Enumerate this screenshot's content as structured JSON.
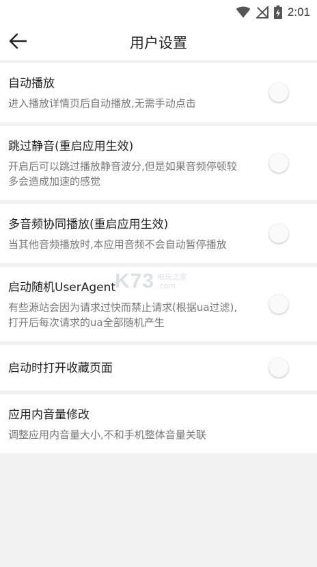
{
  "status_bar": {
    "time": "2:01",
    "icons": [
      "wifi-icon",
      "no-signal-icon",
      "battery-charging-icon"
    ]
  },
  "app_bar": {
    "title": "用户设置",
    "back_icon": "arrow-left-icon"
  },
  "settings": [
    {
      "title": "自动播放",
      "desc": "进入播放详情页后自动播放,无需手动点击",
      "enabled": false
    },
    {
      "title": "跳过静音(重启应用生效)",
      "desc": "开启后可以跳过播放静音波分,但是如果音频停顿较多会造成加速的感觉",
      "enabled": false
    },
    {
      "title": "多音频协同播放(重启应用生效)",
      "desc": "当其他音频播放时,本应用音频不会自动暂停播放",
      "enabled": false
    },
    {
      "title": "启动随机UserAgent",
      "desc": "有些源站会因为请求过快而禁止请求(根据ua过滤),打开后每次请求的ua全部随机产生",
      "enabled": false
    },
    {
      "title": "启动时打开收藏页面",
      "enabled": false
    },
    {
      "title": "应用内音量修改",
      "desc": "调整应用内音量大小,不和手机整体音量关联"
    }
  ],
  "watermark": {
    "main": "K73",
    "sub_line1": "电玩之家",
    "sub_line2": ".com"
  }
}
